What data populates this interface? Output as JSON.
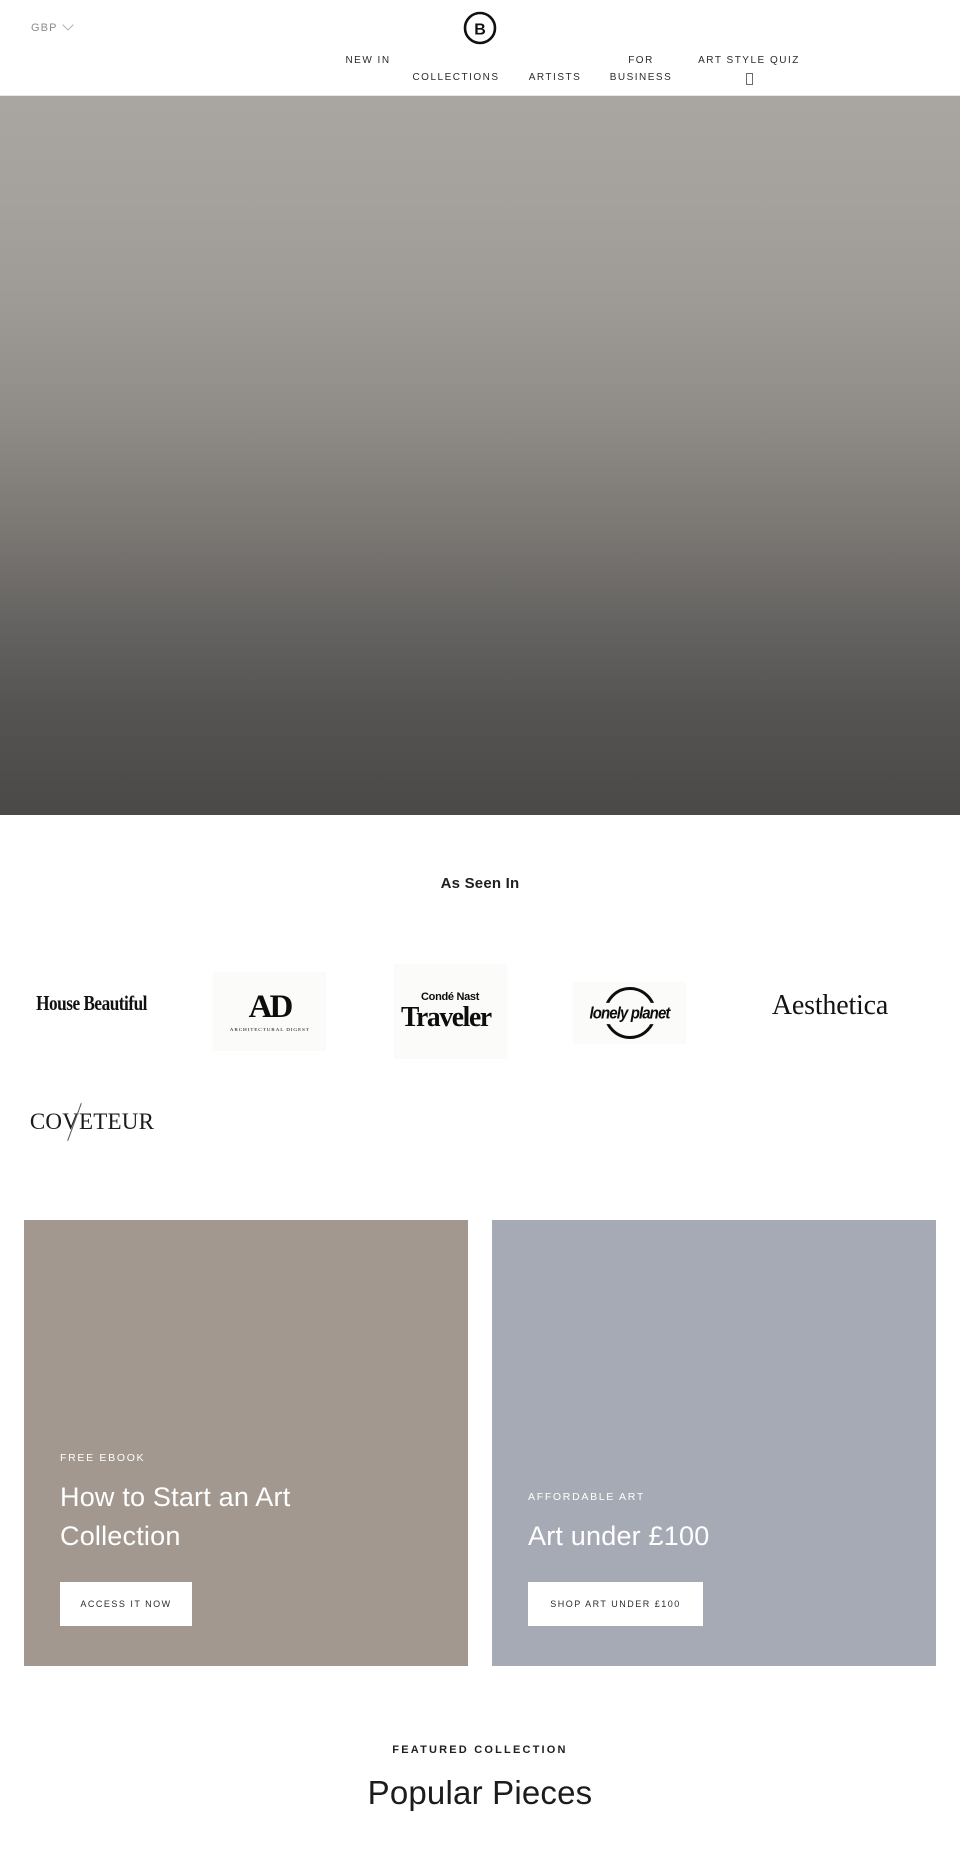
{
  "header": {
    "currency": {
      "code": "GBP",
      "chevron_icon": "chevron-down-icon"
    },
    "logo": {
      "letter": "B",
      "icon": "brand-circle-b-logo"
    },
    "nav": [
      {
        "label": "NEW IN",
        "key": "new-in"
      },
      {
        "label": "COLLECTIONS",
        "key": "collections"
      },
      {
        "label": "ARTISTS",
        "key": "artists"
      },
      {
        "label": "FOR BUSINESS",
        "key": "for-business"
      },
      {
        "label": "ART STYLE QUIZ",
        "key": "art-style-quiz",
        "glyph": "missing-glyph-box"
      }
    ]
  },
  "hero": {
    "gradient_top": "#a9a6a1",
    "gradient_bottom": "#4a4947"
  },
  "press": {
    "title": "As Seen In",
    "logos": [
      {
        "name": "House Beautiful",
        "text": "House Beautiful"
      },
      {
        "name": "Architectural Digest",
        "mark": "AD",
        "sub": "ARCHITECTURAL DIGEST"
      },
      {
        "name": "Condé Nast Traveler",
        "top": "Condé Nast",
        "main": "Traveler"
      },
      {
        "name": "Lonely Planet",
        "text": "lonely planet"
      },
      {
        "name": "Aesthetica",
        "text": "Aesthetica"
      },
      {
        "name": "Coveteur",
        "text": "COVETEUR"
      }
    ]
  },
  "promos": [
    {
      "key": "free-ebook",
      "eyebrow": "FREE EBOOK",
      "heading": "How to Start an Art Collection",
      "button": "ACCESS IT NOW",
      "bg": "#a2988f"
    },
    {
      "key": "affordable-art",
      "eyebrow": "AFFORDABLE ART",
      "heading": "Art under £100",
      "button": "SHOP ART UNDER £100",
      "bg": "#a6aab4"
    }
  ],
  "featured": {
    "eyebrow": "FEATURED COLLECTION",
    "title": "Popular Pieces"
  }
}
